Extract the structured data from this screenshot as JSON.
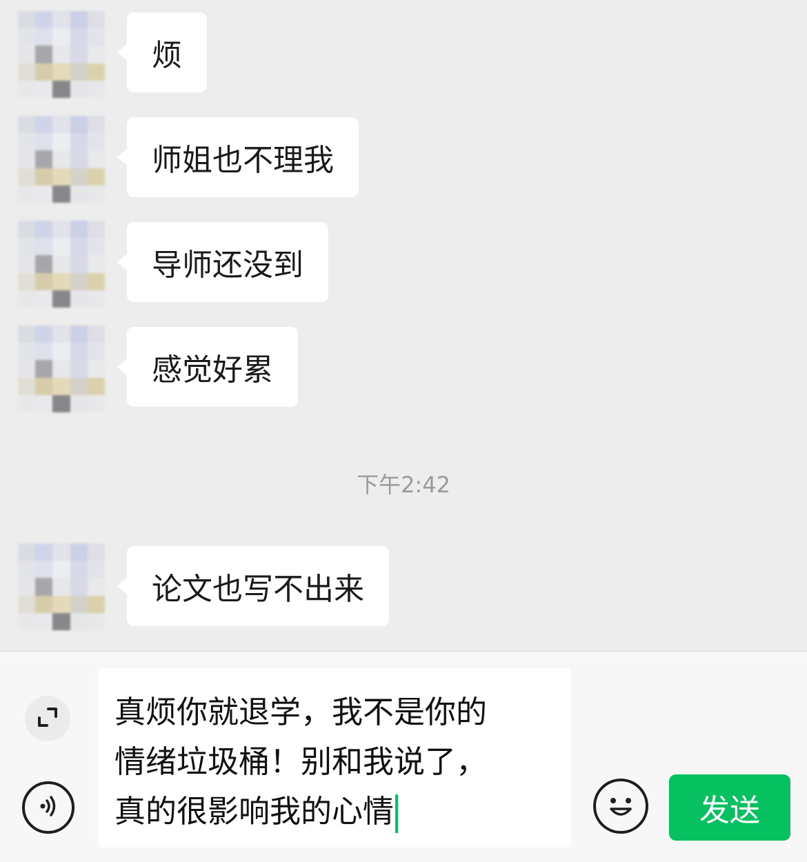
{
  "messages": [
    {
      "text": "烦"
    },
    {
      "text": "师姐也不理我"
    },
    {
      "text": "导师还没到"
    },
    {
      "text": "感觉好累"
    },
    {
      "text": "论文也写不出来"
    }
  ],
  "timestamp": "下午2:42",
  "input": {
    "lines": [
      "真烦你就退学，我不是你的",
      "情绪垃圾桶！别和我说了，",
      "真的很影响我的心情"
    ]
  },
  "send_label": "发送",
  "colors": {
    "accent": "#07c160",
    "chat_background": "#ededed",
    "bubble": "#ffffff"
  },
  "icons": [
    "expand-icon",
    "voice-icon",
    "emoji-icon"
  ]
}
